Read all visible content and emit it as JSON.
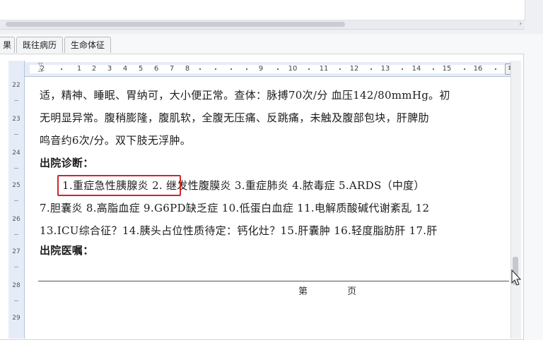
{
  "tabs": [
    "果",
    "既往病历",
    "生命体征"
  ],
  "ruler": {
    "top_labels": [
      "2",
      "1",
      "2",
      "3",
      "4",
      "5",
      "6",
      "7",
      "8",
      "9",
      "10",
      "11",
      "12",
      "13",
      "14",
      "15",
      "16"
    ],
    "left_labels": [
      "22",
      "23",
      "24",
      "25",
      "26",
      "27",
      "28",
      "29"
    ]
  },
  "document": {
    "lines": [
      "适，精神、睡眠、胃纳可，大小便正常。查体：脉搏70次/分 血压142/80mmHg。初",
      "无明显异常。腹稍膨隆，腹肌软，全腹无压痛、反跳痛，未触及腹部包块，肝脾肋",
      "鸣音约6次/分。双下肢无浮肿。"
    ],
    "discharge_diagnosis_heading": "出院诊断：",
    "diagnosis_lines": [
      "1.重症急性胰腺炎 2. 继发性腹膜炎 3.重症肺炎 4.脓毒症 5.ARDS（中度）",
      "7.胆囊炎 8.高脂血症 9.G6PD缺乏症 10.低蛋白血症 11.电解质酸碱代谢紊乱 12",
      "13.ICU综合征？14.胰头占位性质待定：钙化灶？15.肝囊肿 16.轻度脂肪肝 17.肝"
    ],
    "discharge_orders_heading": "出院医嘱：",
    "footer_text": "第 页"
  }
}
